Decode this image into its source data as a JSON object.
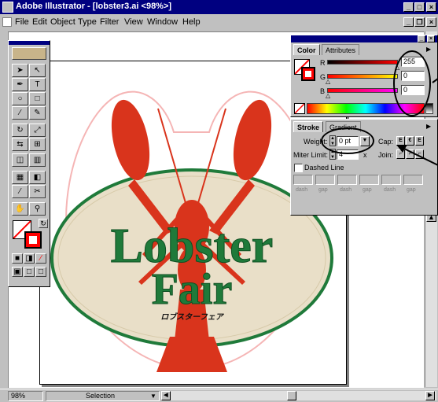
{
  "window": {
    "title": "Adobe Illustrator - [lobster3.ai <98%>]"
  },
  "menubar": {
    "items": [
      "File",
      "Edit",
      "Object",
      "Type",
      "Filter",
      "View",
      "Window",
      "Help"
    ]
  },
  "artwork": {
    "line1": "Lobster",
    "line2": "Fair",
    "subtitle": "ロブスターフェア",
    "colors": {
      "green": "#1f7a3a",
      "lobster": "#d9341c",
      "stone": "#e9dfc8",
      "border_pink": "#f5b5b5"
    }
  },
  "color_panel": {
    "tabs": [
      "Color",
      "Attributes"
    ],
    "r_label": "R",
    "g_label": "G",
    "b_label": "B",
    "r_value": "255",
    "g_value": "0",
    "b_value": "0",
    "fill_color": "#ff0000"
  },
  "stroke_panel": {
    "tabs": [
      "Stroke",
      "Gradient"
    ],
    "weight_label": "Weight:",
    "weight_value": "0 pt",
    "cap_label": "Cap:",
    "miter_label": "Miter Limit:",
    "miter_value": "4",
    "miter_unit": "x",
    "join_label": "Join:",
    "dashed_label": "Dashed Line",
    "dash_labels": [
      "dash",
      "gap",
      "dash",
      "gap",
      "dash",
      "gap"
    ]
  },
  "statusbar": {
    "zoom": "98%",
    "mode": "Selection"
  }
}
